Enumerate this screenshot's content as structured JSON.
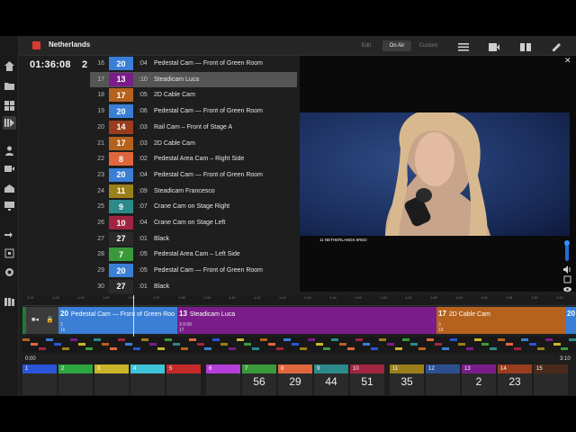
{
  "header": {
    "project": "Netherlands",
    "modes": [
      "Edit",
      "On Air",
      "Custom"
    ],
    "active_mode": "On Air"
  },
  "nav_icons": [
    "home-icon",
    "folder-icon",
    "grid-icon",
    "playlist-icon",
    "person-icon",
    "camera-icon",
    "broadcast-icon",
    "monitor-icon",
    "transfer-icon",
    "export-icon",
    "settings-icon",
    "library-icon"
  ],
  "toolbar_icons": [
    "list-icon",
    "media-icon",
    "columns-icon",
    "edit-icon"
  ],
  "clock": {
    "time": "01:36:08",
    "count": "2"
  },
  "shots": [
    {
      "row": "16",
      "cam": "20",
      "color": "#3a7fd5",
      "dur": ":04",
      "name": "Pedestal Cam — Front of Green Room",
      "hl": false
    },
    {
      "row": "17",
      "cam": "13",
      "color": "#7a1d8a",
      "dur": ":10",
      "name": "Steadicam Luca",
      "hl": true
    },
    {
      "row": "18",
      "cam": "17",
      "color": "#b5621e",
      "dur": ":05",
      "name": "2D Cable Cam",
      "hl": false
    },
    {
      "row": "19",
      "cam": "20",
      "color": "#3a7fd5",
      "dur": ":06",
      "name": "Pedestal Cam — Front of Green Room",
      "hl": false
    },
    {
      "row": "20",
      "cam": "14",
      "color": "#9a3d1f",
      "dur": ":03",
      "name": "Rail Cam – Front of Stage A",
      "hl": false
    },
    {
      "row": "21",
      "cam": "17",
      "color": "#b5621e",
      "dur": ":03",
      "name": "2D Cable Cam",
      "hl": false
    },
    {
      "row": "22",
      "cam": "8",
      "color": "#e0673c",
      "dur": ":02",
      "name": "Pedestal Area Cam – Right Side",
      "hl": false
    },
    {
      "row": "23",
      "cam": "20",
      "color": "#3a7fd5",
      "dur": ":04",
      "name": "Pedestal Cam — Front of Green Room",
      "hl": false
    },
    {
      "row": "24",
      "cam": "11",
      "color": "#9b7f1a",
      "dur": ":09",
      "name": "Steadicam Francesco",
      "hl": false
    },
    {
      "row": "25",
      "cam": "9",
      "color": "#2c8a8a",
      "dur": ":07",
      "name": "Crane Cam on Stage Right",
      "hl": false
    },
    {
      "row": "26",
      "cam": "10",
      "color": "#a02540",
      "dur": ":04",
      "name": "Crane Cam on Stage Left",
      "hl": false
    },
    {
      "row": "27",
      "cam": "27",
      "color": "#2a2a2a",
      "dur": ":01",
      "name": "Black",
      "hl": false
    },
    {
      "row": "28",
      "cam": "7",
      "color": "#3a9a3a",
      "dur": ":05",
      "name": "Pedestal Area Cam – Left Side",
      "hl": false
    },
    {
      "row": "29",
      "cam": "20",
      "color": "#3a7fd5",
      "dur": ":05",
      "name": "Pedestal Cam — Front of Green Room",
      "hl": false
    },
    {
      "row": "30",
      "cam": "27",
      "color": "#2a2a2a",
      "dur": ":01",
      "name": "Black",
      "hl": false
    }
  ],
  "preview": {
    "lower_third": "11 NETHERLANDS 6RED"
  },
  "ruler_ticks": [
    "1:02",
    "1:03",
    "1:04",
    "1:05",
    "1:06",
    "1:07",
    "1:08",
    "1:09",
    "1:40",
    "1:41",
    "1:42",
    "1:43",
    "1:44",
    "1:45",
    "1:46",
    "1:47",
    "1:48",
    "1:49",
    "1:50",
    "1:51",
    "1:52",
    "1:53"
  ],
  "timeline": [
    {
      "cam": "20",
      "name": "Pedestal Cam — Front of Green Roo",
      "color": "#3a7fd5",
      "sub": "3",
      "sub2": "16",
      "time": ""
    },
    {
      "cam": "13",
      "name": "Steadicam Luca",
      "color": "#7a1d8a",
      "sub": "3",
      "sub2": "17",
      "time": "0:09"
    },
    {
      "cam": "17",
      "name": "2D Cable Cam",
      "color": "#b5621e",
      "sub": "3",
      "sub2": "18",
      "time": ""
    },
    {
      "cam": "20",
      "name": "",
      "color": "#3a7fd5",
      "sub": "",
      "sub2": "",
      "time": ""
    }
  ],
  "timecode": {
    "start": "0:00",
    "end": "3:10"
  },
  "cameras": [
    {
      "num": "1",
      "color": "#2a55d8",
      "count": ""
    },
    {
      "num": "2",
      "color": "#2ea640",
      "count": ""
    },
    {
      "num": "3",
      "color": "#c9b52a",
      "count": ""
    },
    {
      "num": "4",
      "color": "#3fc3d8",
      "count": ""
    },
    {
      "num": "5",
      "color": "#c52a2a",
      "count": ""
    },
    {
      "num": "6",
      "color": "#b43ed8",
      "count": ""
    },
    {
      "num": "7",
      "color": "#3a9a3a",
      "count": "56"
    },
    {
      "num": "8",
      "color": "#e0673c",
      "count": "29"
    },
    {
      "num": "9",
      "color": "#2c8a8a",
      "count": "44"
    },
    {
      "num": "10",
      "color": "#a02540",
      "count": "51"
    },
    {
      "num": "11",
      "color": "#9b7f1a",
      "count": "35"
    },
    {
      "num": "12",
      "color": "#2d4f8f",
      "count": ""
    },
    {
      "num": "13",
      "color": "#7a1d8a",
      "count": "2"
    },
    {
      "num": "14",
      "color": "#9a3d1f",
      "count": "23"
    },
    {
      "num": "15",
      "color": "#4a2a1a",
      "count": ""
    }
  ]
}
